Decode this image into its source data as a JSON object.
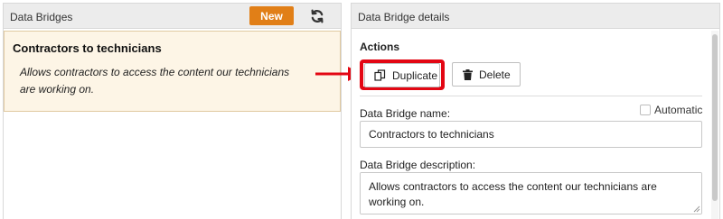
{
  "left_panel": {
    "title": "Data Bridges",
    "new_label": "New",
    "refresh_icon": "refresh-icon",
    "items": [
      {
        "name": "Contractors to technicians",
        "description": "Allows contractors to access the content our technicians are working on."
      }
    ]
  },
  "right_panel": {
    "title": "Data Bridge details",
    "actions_title": "Actions",
    "duplicate_label": "Duplicate",
    "delete_label": "Delete",
    "automatic_label": "Automatic",
    "automatic_checked": false,
    "name_label": "Data Bridge name:",
    "name_value": "Contractors to technicians",
    "description_label": "Data Bridge description:",
    "description_value": "Allows contractors to access the content our technicians are working on."
  },
  "colors": {
    "accent": "#e17f17",
    "highlight": "#e30613",
    "selected_bg": "#fdf5e6"
  }
}
